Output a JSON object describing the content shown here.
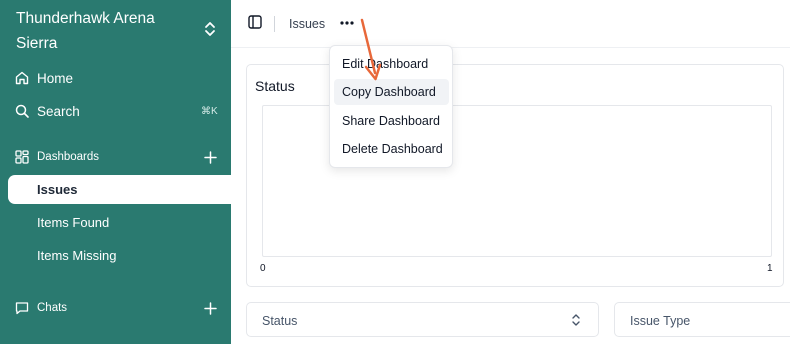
{
  "sidebar": {
    "workspace_name": "Thunderhawk Arena Sierra",
    "nav": [
      {
        "label": "Home"
      },
      {
        "label": "Search",
        "shortcut": "⌘K"
      }
    ],
    "dashboards_label": "Dashboards",
    "dashboards": [
      {
        "label": "Issues",
        "active": true
      },
      {
        "label": "Items Found"
      },
      {
        "label": "Items Missing"
      }
    ],
    "chats_label": "Chats"
  },
  "topbar": {
    "breadcrumb": "Issues"
  },
  "card": {
    "title": "Status",
    "x_tick_min": "0",
    "x_tick_max": "1"
  },
  "filters": [
    {
      "label": "Status"
    },
    {
      "label": "Issue Type"
    }
  ],
  "menu": {
    "items": [
      {
        "label": "Edit Dashboard"
      },
      {
        "label": "Copy Dashboard",
        "highlighted": true
      },
      {
        "label": "Share Dashboard"
      },
      {
        "label": "Delete Dashboard"
      }
    ]
  },
  "colors": {
    "sidebar_bg": "#2a7a70",
    "annotation_arrow": "#e8683a"
  }
}
